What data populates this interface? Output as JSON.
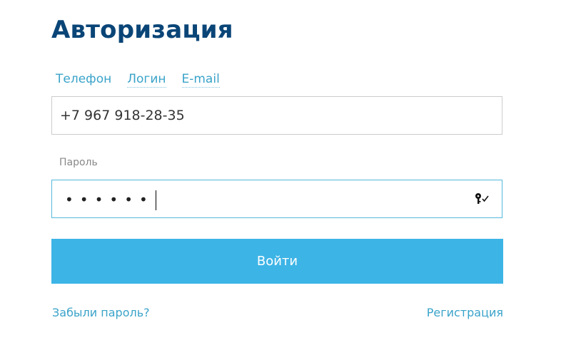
{
  "page": {
    "title": "Авторизация"
  },
  "tabs": [
    {
      "label": "Телефон",
      "active": true
    },
    {
      "label": "Логин",
      "active": false
    },
    {
      "label": "E-mail",
      "active": false
    }
  ],
  "login_input": {
    "value": "+7 967 918-28-35"
  },
  "password": {
    "label": "Пароль",
    "masked_value": "••••••",
    "icon": "key-check-icon"
  },
  "buttons": {
    "submit_label": "Войти"
  },
  "links": {
    "forgot_password": "Забыли пароль?",
    "register": "Регистрация"
  },
  "colors": {
    "title": "#0a4577",
    "accent": "#3db4e6",
    "link": "#3aa3c9"
  }
}
